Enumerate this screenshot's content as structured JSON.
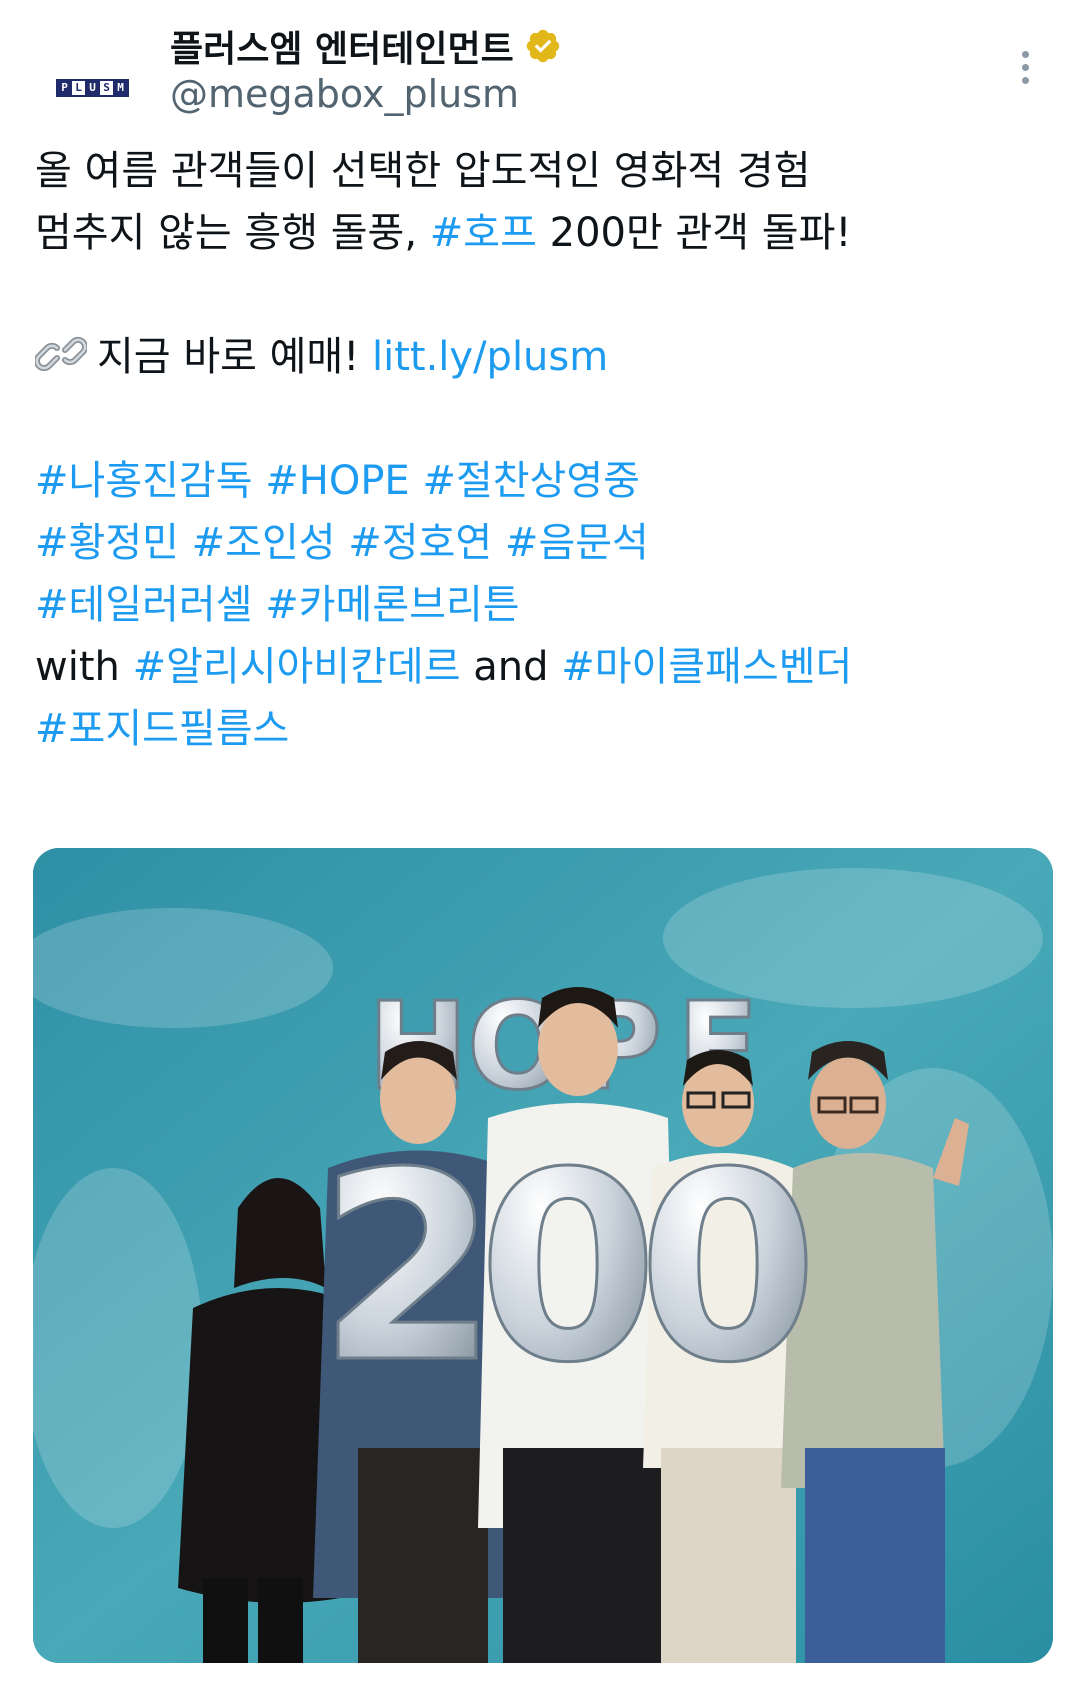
{
  "tweet": {
    "author": {
      "display_name": "플러스엠 엔터테인먼트",
      "handle": "@megabox_plusm",
      "avatar_logo_letters": [
        "P",
        "L",
        "U",
        "S",
        "M"
      ],
      "verified": true
    },
    "text": {
      "line1": "올 여름 관객들이 선택한 압도적인 영화적 경험",
      "line2_prefix": "멈추지 않는 흥행 돌풍, ",
      "line2_hashtag": "#호프",
      "line2_suffix": " 200만 관객 돌파!",
      "line3_prefix": "지금 바로 예매! ",
      "line3_link": "litt.ly/plusm",
      "hashtag_rows": [
        [
          "#나홍진감독",
          "#HOPE",
          "#절찬상영중"
        ],
        [
          "#황정민",
          "#조인성",
          "#정호연",
          "#음문석"
        ],
        [
          "#테일러러셀",
          "#카메론브리튼"
        ]
      ],
      "with_word": "with ",
      "with_hashtag": "#알리시아비칸데르",
      "and_word": " and ",
      "and_hashtag": "#마이클패스벤더",
      "last_hashtag": "#포지드필름스"
    },
    "photo": {
      "balloon_word": "HOPE",
      "balloon_number": "200"
    }
  },
  "icons": {
    "verified": "verified-badge-icon",
    "more": "more-options-icon",
    "link": "link-emoji-icon"
  },
  "colors": {
    "link_blue": "#1d9bf0",
    "verified_gold": "#e2b719",
    "text_primary": "#0f1419",
    "text_secondary": "#536471",
    "photo_wall": "#3aa0b3"
  }
}
